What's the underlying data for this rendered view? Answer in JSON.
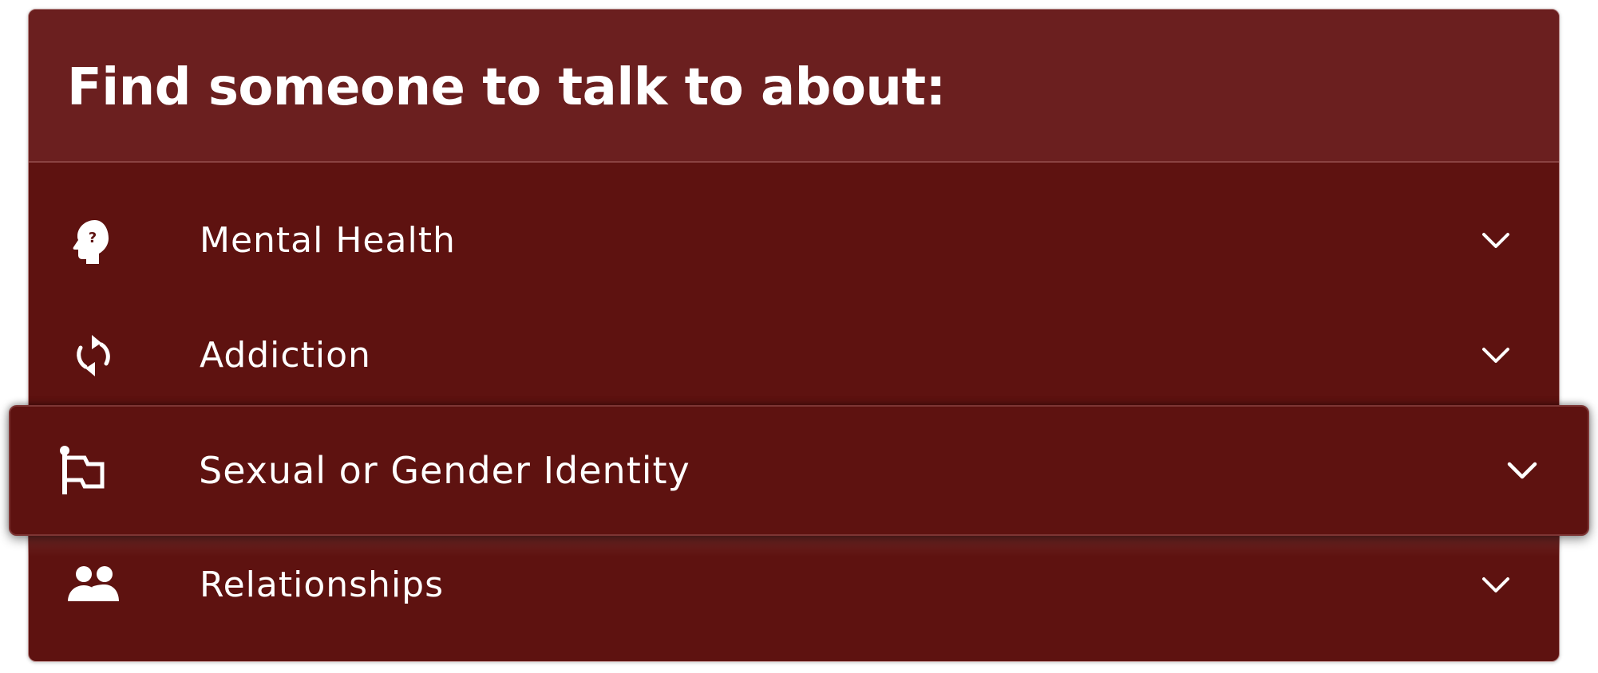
{
  "panel": {
    "title": "Find someone to talk to about:"
  },
  "topics": [
    {
      "label": "Mental Health",
      "icon": "head-question-icon"
    },
    {
      "label": "Addiction",
      "icon": "cycle-arrows-icon"
    },
    {
      "label": "Sexual or Gender Identity",
      "icon": "flag-icon",
      "state": "hovered"
    },
    {
      "label": "Relationships",
      "icon": "people-icon"
    }
  ],
  "colors": {
    "panel_background": "#5e1210",
    "header_background": "#6b1f1f",
    "text": "#ffffff"
  }
}
